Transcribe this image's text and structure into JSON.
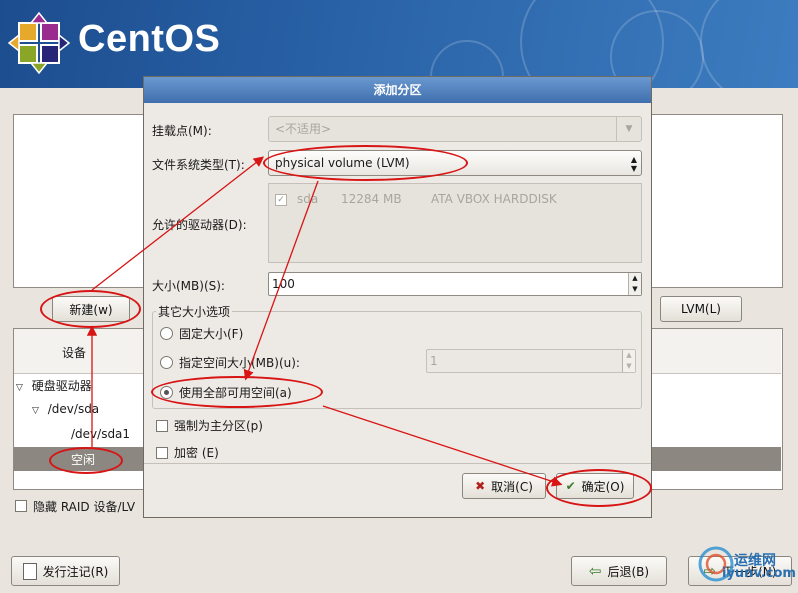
{
  "header": {
    "logo_text": "CentOS"
  },
  "main": {
    "new_button": "新建(w)",
    "lvm_button": "LVM(L)",
    "table_header_device": "设备",
    "tree": [
      {
        "label": "硬盘驱动器",
        "level": 0,
        "expanded": true
      },
      {
        "label": "/dev/sda",
        "level": 1,
        "expanded": true
      },
      {
        "label": "/dev/sda1",
        "level": 2
      },
      {
        "label": "空闲",
        "level": 2,
        "selected": true
      }
    ],
    "hide_raid_label": "隐藏 RAID 设备/LV",
    "release_notes_button": "发行注记(R)",
    "back_button": "后退(B)",
    "next_button": "下一步(N)"
  },
  "dialog": {
    "title": "添加分区",
    "mount_label": "挂载点(M):",
    "mount_value": "<不适用>",
    "fstype_label": "文件系统类型(T):",
    "fstype_value": "physical volume (LVM)",
    "drives_label": "允许的驱动器(D):",
    "drive_row": {
      "name": "sda",
      "size": "12284 MB",
      "model": "ATA VBOX HARDDISK",
      "checked": true
    },
    "size_label": "大小(MB)(S):",
    "size_value": "100",
    "other_size_group": "其它大小选项",
    "radio_fixed": "固定大小(F)",
    "radio_upto": "指定空间大小(MB)(u):",
    "upto_value": "1",
    "radio_fill": "使用全部可用空间(a)",
    "selected_radio": "fill",
    "force_primary": "强制为主分区(p)",
    "encrypt": "加密 (E)",
    "cancel_button": "取消(C)",
    "ok_button": "确定(O)"
  },
  "watermark": {
    "cn": "运维网",
    "en": "iyunv.com"
  },
  "colors": {
    "annotation": "#d81414",
    "banner": "#2a63a8",
    "selection": "#8c8780"
  }
}
